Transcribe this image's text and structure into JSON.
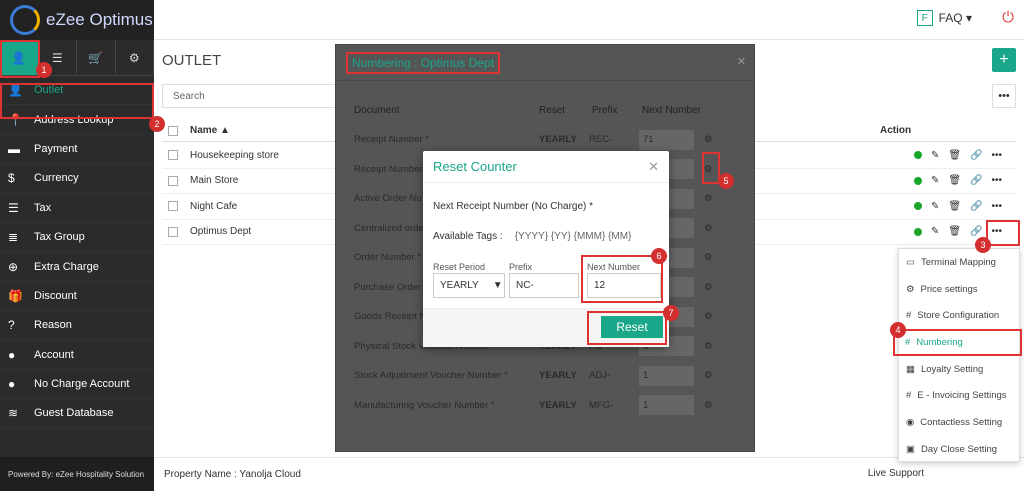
{
  "app": {
    "brand": "eZee Optimus",
    "powered": "Powered By: eZee Hospitality Solution"
  },
  "topbar": {
    "faq_badge": "F",
    "faq": "FAQ ▾"
  },
  "sidebar": {
    "items": [
      {
        "label": "Outlet",
        "icon": "user-icon"
      },
      {
        "label": "Address Lookup",
        "icon": "pin-icon"
      },
      {
        "label": "Payment",
        "icon": "card-icon"
      },
      {
        "label": "Currency",
        "icon": "dollar-icon"
      },
      {
        "label": "Tax",
        "icon": "menu-icon"
      },
      {
        "label": "Tax Group",
        "icon": "list-icon"
      },
      {
        "label": "Extra Charge",
        "icon": "plus-icon"
      },
      {
        "label": "Discount",
        "icon": "gift-icon"
      },
      {
        "label": "Reason",
        "icon": "question-icon"
      },
      {
        "label": "Account",
        "icon": "person-icon"
      },
      {
        "label": "No Charge Account",
        "icon": "person-icon"
      },
      {
        "label": "Guest Database",
        "icon": "database-icon"
      }
    ]
  },
  "main": {
    "title": "OUTLET",
    "search_placeholder": "Search",
    "col_name": "Name ▲",
    "col_action": "Action",
    "rows": [
      "Housekeeping store",
      "Main Store",
      "Night Cafe",
      "Optimus Dept"
    ]
  },
  "dropdown": [
    "Terminal Mapping",
    "Price settings",
    "Store Configuration",
    "Numbering",
    "Loyalty Setting",
    "E - Invoicing Settings",
    "Contactless Setting",
    "Day Close Setting"
  ],
  "numbering": {
    "title": "Numbering : Optimus Dept",
    "col_doc": "Document",
    "col_reset": "Reset",
    "col_prefix": "Prefix",
    "col_next": "Next Number",
    "rows": [
      {
        "doc": "Receipt Number *",
        "reset": "YEARLY",
        "prefix": "REC-",
        "next": "71"
      },
      {
        "doc": "Receipt Number",
        "reset": "",
        "prefix": "",
        "next": ""
      },
      {
        "doc": "Active Order Nu",
        "reset": "",
        "prefix": "",
        "next": ""
      },
      {
        "doc": "Centralized orde",
        "reset": "",
        "prefix": "",
        "next": ""
      },
      {
        "doc": "Order Number *",
        "reset": "",
        "prefix": "",
        "next": ""
      },
      {
        "doc": "Purchase Order",
        "reset": "",
        "prefix": "",
        "next": ""
      },
      {
        "doc": "Goods Receipt N",
        "reset": "",
        "prefix": "",
        "next": ""
      },
      {
        "doc": "Physical Stock Voucher Number *",
        "reset": "YEARLY",
        "prefix": "PS-",
        "next": "3"
      },
      {
        "doc": "Stock Adjustment Voucher Number *",
        "reset": "YEARLY",
        "prefix": "ADJ-",
        "next": "1"
      },
      {
        "doc": "Manufacturing Voucher Number *",
        "reset": "YEARLY",
        "prefix": "MFG-",
        "next": "1"
      }
    ]
  },
  "reset": {
    "title": "Reset Counter",
    "label": "Next Receipt Number (No Charge) *",
    "tags_label": "Available Tags :",
    "tags": "{YYYY} {YY} {MMM} {MM}",
    "period_label": "Reset Period",
    "period": "YEARLY",
    "prefix_label": "Prefix",
    "prefix": "NC-",
    "next_label": "Next Number",
    "next": "12",
    "button": "Reset"
  },
  "footer": {
    "property": "Property Name : Yanolja Cloud",
    "live": "Live Support"
  }
}
